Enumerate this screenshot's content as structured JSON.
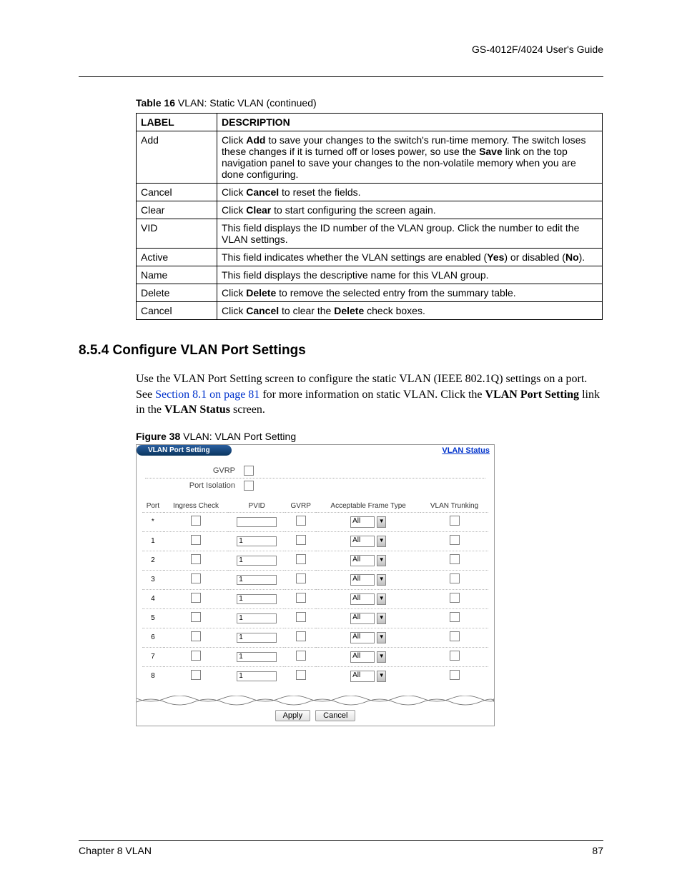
{
  "header": {
    "right": "GS-4012F/4024 User's Guide"
  },
  "tableCaption": {
    "bold": "Table 16",
    "rest": "   VLAN: Static VLAN  (continued)"
  },
  "tableHeaders": {
    "label": "LABEL",
    "desc": "DESCRIPTION"
  },
  "rows": [
    {
      "label": "Add",
      "parts": [
        "Click ",
        "Add",
        " to save your changes to the switch's run-time memory. The switch loses these changes if it is turned off or loses power, so use the ",
        "Save",
        " link on the top navigation panel to save your changes to the non-volatile memory when you are done configuring."
      ]
    },
    {
      "label": "Cancel",
      "parts": [
        "Click ",
        "Cancel",
        " to reset the fields."
      ]
    },
    {
      "label": "Clear",
      "parts": [
        "Click ",
        "Clear",
        " to start configuring the screen again."
      ]
    },
    {
      "label": "VID",
      "parts": [
        "This field displays the ID number of the VLAN group. Click the number to edit the VLAN settings."
      ]
    },
    {
      "label": "Active",
      "parts": [
        "This field indicates whether the VLAN settings are enabled (",
        "Yes",
        ") or disabled (",
        "No",
        ")."
      ]
    },
    {
      "label": "Name",
      "parts": [
        "This field displays the descriptive name for this VLAN group."
      ]
    },
    {
      "label": "Delete",
      "parts": [
        "Click ",
        "Delete",
        " to remove the selected entry from the summary table."
      ]
    },
    {
      "label": "Cancel",
      "parts": [
        "Click ",
        "Cancel",
        " to clear the ",
        "Delete",
        " check boxes."
      ]
    }
  ],
  "sectionHeading": "8.5.4  Configure VLAN Port Settings",
  "paragraph": {
    "p1": "Use the VLAN Port Setting screen to configure the static VLAN (IEEE 802.1Q) settings on a port. See ",
    "link": "Section 8.1 on page 81",
    "p2": " for more information on static VLAN. Click the ",
    "b1": "VLAN Port Setting",
    "p3": " link in the ",
    "b2": "VLAN Status",
    "p4": " screen."
  },
  "figureCaption": {
    "bold": "Figure 38",
    "rest": "   VLAN: VLAN Port Setting"
  },
  "ui": {
    "title": "VLAN Port Setting",
    "statusLink": "VLAN Status",
    "gvrp": "GVRP",
    "portIsolation": "Port Isolation",
    "cols": {
      "port": "Port",
      "ingress": "Ingress Check",
      "pvid": "PVID",
      "gvrp": "GVRP",
      "aft": "Acceptable Frame Type",
      "trunk": "VLAN Trunking"
    },
    "rows": [
      {
        "port": "*",
        "pvid": "",
        "aft": "All"
      },
      {
        "port": "1",
        "pvid": "1",
        "aft": "All"
      },
      {
        "port": "2",
        "pvid": "1",
        "aft": "All"
      },
      {
        "port": "3",
        "pvid": "1",
        "aft": "All"
      },
      {
        "port": "4",
        "pvid": "1",
        "aft": "All"
      },
      {
        "port": "5",
        "pvid": "1",
        "aft": "All"
      },
      {
        "port": "6",
        "pvid": "1",
        "aft": "All"
      },
      {
        "port": "7",
        "pvid": "1",
        "aft": "All"
      },
      {
        "port": "8",
        "pvid": "1",
        "aft": "All"
      }
    ],
    "applyBtn": "Apply",
    "cancelBtn": "Cancel"
  },
  "footer": {
    "left": "Chapter 8 VLAN",
    "right": "87"
  }
}
